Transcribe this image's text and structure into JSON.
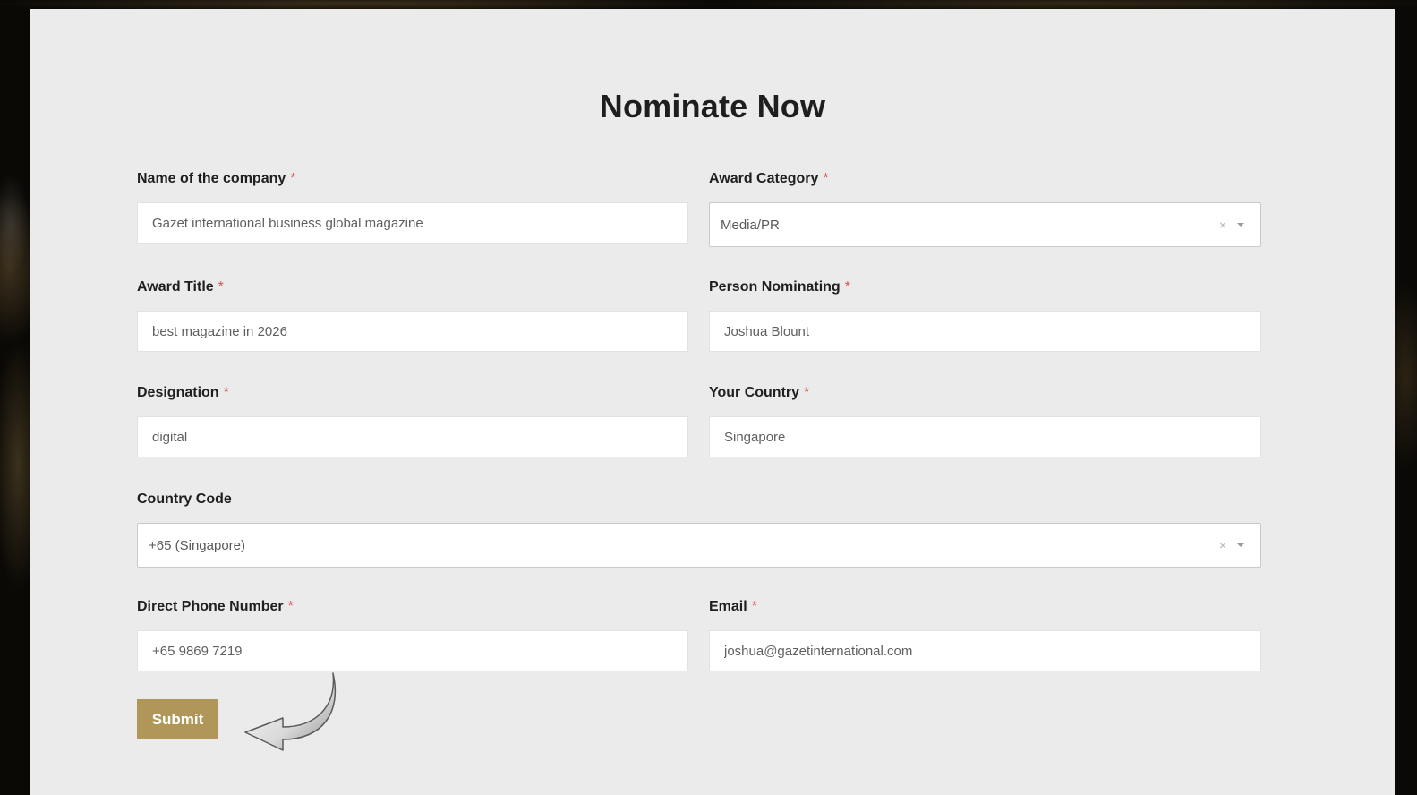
{
  "form": {
    "title": "Nominate Now",
    "required_mark": "*",
    "fields": {
      "company": {
        "label": "Name of the company",
        "value": "Gazet international business global magazine"
      },
      "award_category": {
        "label": "Award Category",
        "value": "Media/PR",
        "clear_icon": "×"
      },
      "award_title": {
        "label": "Award Title",
        "value": "best magazine in 2026"
      },
      "person_nominating": {
        "label": "Person Nominating",
        "value": "Joshua Blount"
      },
      "designation": {
        "label": "Designation",
        "value": "digital"
      },
      "country": {
        "label": "Your Country",
        "value": "Singapore"
      },
      "country_code": {
        "label": "Country Code",
        "value": "+65 (Singapore)",
        "clear_icon": "×"
      },
      "phone": {
        "label": "Direct Phone Number",
        "value": "+65 9869 7219"
      },
      "email": {
        "label": "Email",
        "value": "joshua@gazetinternational.com"
      }
    },
    "submit_label": "Submit"
  },
  "colors": {
    "panel_bg": "#ebebeb",
    "accent": "#b09659",
    "required": "#d9534f"
  },
  "icons": {
    "arrow": "curved-arrow-icon",
    "caret": "chevron-down-icon",
    "clear": "close-icon"
  }
}
